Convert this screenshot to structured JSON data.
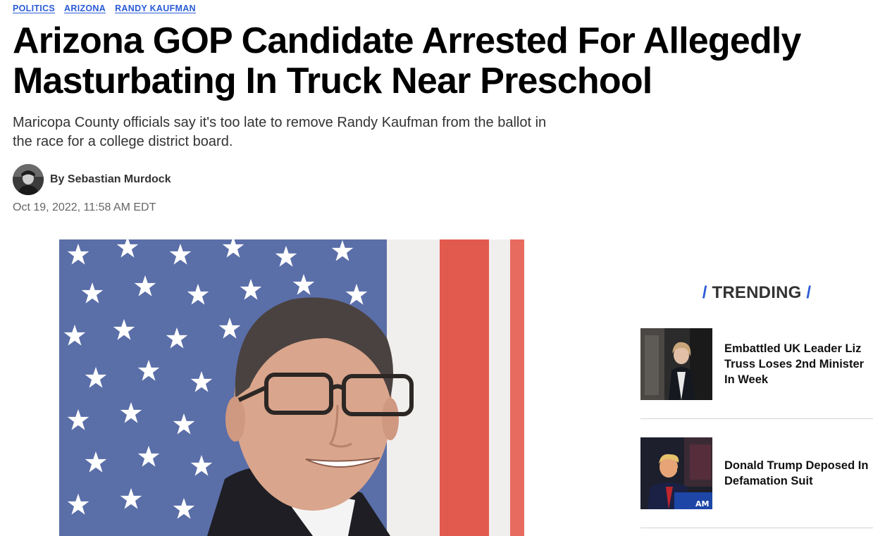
{
  "tags": [
    "POLITICS",
    "ARIZONA",
    "RANDY KAUFMAN"
  ],
  "headline": "Arizona GOP Candidate Arrested For Allegedly Masturbating In Truck Near Preschool",
  "dek": "Maricopa County officials say it's too late to remove Randy Kaufman from the ballot in the race for a college district board.",
  "byline": "By Sebastian Murdock",
  "timestamp": "Oct 19, 2022, 11:58 AM EDT",
  "trending": {
    "heading": "TRENDING",
    "items": [
      {
        "title": "Embattled UK Leader Liz Truss Loses 2nd Minister In Week"
      },
      {
        "title": "Donald Trump Deposed In Defamation Suit"
      }
    ]
  },
  "colors": {
    "link_blue": "#2a5bd7",
    "headline": "#000000",
    "body_text": "#333333",
    "meta_text": "#666666"
  }
}
